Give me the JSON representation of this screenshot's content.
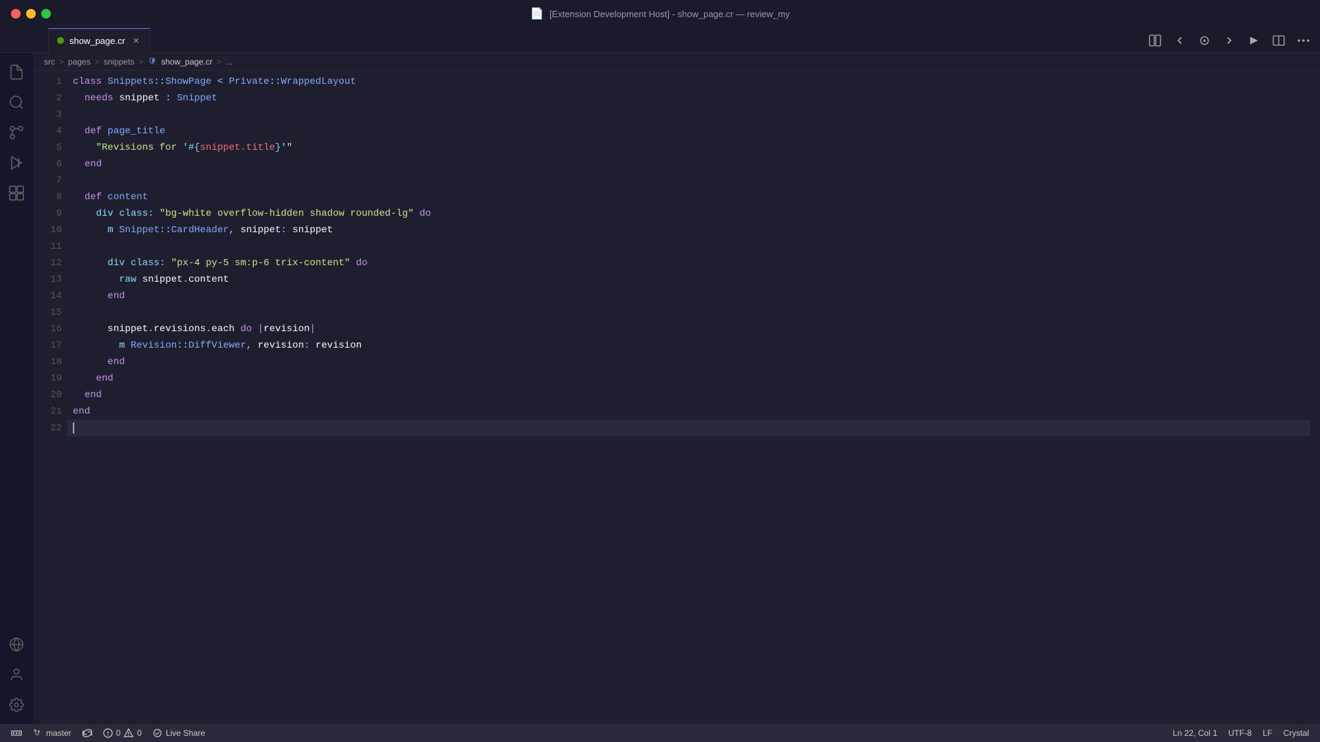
{
  "titleBar": {
    "title": "[Extension Development Host] - show_page.cr — review_my"
  },
  "tabs": [
    {
      "name": "show_page.cr",
      "active": true,
      "modified": false,
      "icon": "crystal-icon"
    }
  ],
  "breadcrumb": {
    "items": [
      "src",
      "pages",
      "snippets",
      "show_page.cr",
      "..."
    ],
    "separator": ">"
  },
  "toolbar": {
    "buttons": [
      "split-left",
      "go-back",
      "go-marker",
      "go-forward",
      "run-debug",
      "split-editor",
      "more-actions"
    ]
  },
  "code": {
    "lines": [
      {
        "num": 1,
        "tokens": [
          {
            "t": "kw",
            "v": "class "
          },
          {
            "t": "cls",
            "v": "Snippets"
          },
          {
            "t": "sym",
            "v": "::"
          },
          {
            "t": "cls",
            "v": "ShowPage"
          },
          {
            "t": "plain",
            "v": " "
          },
          {
            "t": "sym",
            "v": "<"
          },
          {
            "t": "plain",
            "v": " "
          },
          {
            "t": "cls",
            "v": "Private"
          },
          {
            "t": "sym",
            "v": "::"
          },
          {
            "t": "cls",
            "v": "WrappedLayout"
          }
        ]
      },
      {
        "num": 2,
        "tokens": [
          {
            "t": "plain",
            "v": "  "
          },
          {
            "t": "kw",
            "v": "needs "
          },
          {
            "t": "plain",
            "v": "snippet "
          },
          {
            "t": "sym",
            "v": ": "
          },
          {
            "t": "cls",
            "v": "Snippet"
          }
        ]
      },
      {
        "num": 3,
        "tokens": []
      },
      {
        "num": 4,
        "tokens": [
          {
            "t": "plain",
            "v": "  "
          },
          {
            "t": "kw",
            "v": "def "
          },
          {
            "t": "meth",
            "v": "page_title"
          }
        ]
      },
      {
        "num": 5,
        "tokens": [
          {
            "t": "plain",
            "v": "    "
          },
          {
            "t": "str",
            "v": "\"Revisions for "
          },
          {
            "t": "interp",
            "v": "'#{"
          },
          {
            "t": "interp-inner",
            "v": "snippet.title"
          },
          {
            "t": "interp",
            "v": "}"
          },
          {
            "t": "str",
            "v": "'\""
          }
        ]
      },
      {
        "num": 6,
        "tokens": [
          {
            "t": "plain",
            "v": "  "
          },
          {
            "t": "kw",
            "v": "end"
          }
        ]
      },
      {
        "num": 7,
        "tokens": []
      },
      {
        "num": 8,
        "tokens": [
          {
            "t": "plain",
            "v": "  "
          },
          {
            "t": "kw",
            "v": "def "
          },
          {
            "t": "meth",
            "v": "content"
          }
        ]
      },
      {
        "num": 9,
        "tokens": [
          {
            "t": "plain",
            "v": "    "
          },
          {
            "t": "kw2",
            "v": "div"
          },
          {
            "t": "plain",
            "v": " "
          },
          {
            "t": "kw2",
            "v": "class"
          },
          {
            "t": "sym",
            "v": ": "
          },
          {
            "t": "str",
            "v": "\"bg-white overflow-hidden shadow rounded-lg\""
          },
          {
            "t": "plain",
            "v": " "
          },
          {
            "t": "kw",
            "v": "do"
          }
        ]
      },
      {
        "num": 10,
        "tokens": [
          {
            "t": "plain",
            "v": "      "
          },
          {
            "t": "kw2",
            "v": "m"
          },
          {
            "t": "plain",
            "v": " "
          },
          {
            "t": "cls",
            "v": "Snippet"
          },
          {
            "t": "sym",
            "v": "::"
          },
          {
            "t": "cls",
            "v": "CardHeader"
          },
          {
            "t": "sym",
            "v": ", "
          },
          {
            "t": "plain",
            "v": "snippet"
          },
          {
            "t": "sym",
            "v": ": "
          },
          {
            "t": "plain",
            "v": "snippet"
          }
        ]
      },
      {
        "num": 11,
        "tokens": []
      },
      {
        "num": 12,
        "tokens": [
          {
            "t": "plain",
            "v": "      "
          },
          {
            "t": "kw2",
            "v": "div"
          },
          {
            "t": "plain",
            "v": " "
          },
          {
            "t": "kw2",
            "v": "class"
          },
          {
            "t": "sym",
            "v": ": "
          },
          {
            "t": "str",
            "v": "\"px-4 py-5 sm:p-6 trix-content\""
          },
          {
            "t": "plain",
            "v": " "
          },
          {
            "t": "kw",
            "v": "do"
          }
        ]
      },
      {
        "num": 13,
        "tokens": [
          {
            "t": "plain",
            "v": "        "
          },
          {
            "t": "kw2",
            "v": "raw"
          },
          {
            "t": "plain",
            "v": " snippet"
          },
          {
            "t": "sym",
            "v": "."
          },
          {
            "t": "plain",
            "v": "content"
          }
        ]
      },
      {
        "num": 14,
        "tokens": [
          {
            "t": "plain",
            "v": "      "
          },
          {
            "t": "kw",
            "v": "end"
          }
        ]
      },
      {
        "num": 15,
        "tokens": []
      },
      {
        "num": 16,
        "tokens": [
          {
            "t": "plain",
            "v": "      "
          },
          {
            "t": "plain",
            "v": "snippet"
          },
          {
            "t": "sym",
            "v": "."
          },
          {
            "t": "plain",
            "v": "revisions"
          },
          {
            "t": "sym",
            "v": "."
          },
          {
            "t": "plain",
            "v": "each "
          },
          {
            "t": "kw",
            "v": "do"
          },
          {
            "t": "plain",
            "v": " "
          },
          {
            "t": "pipe",
            "v": "|"
          },
          {
            "t": "plain",
            "v": "revision"
          },
          {
            "t": "pipe",
            "v": "|"
          }
        ]
      },
      {
        "num": 17,
        "tokens": [
          {
            "t": "plain",
            "v": "        "
          },
          {
            "t": "kw2",
            "v": "m"
          },
          {
            "t": "plain",
            "v": " "
          },
          {
            "t": "cls",
            "v": "Revision"
          },
          {
            "t": "sym",
            "v": "::"
          },
          {
            "t": "cls",
            "v": "DiffViewer"
          },
          {
            "t": "sym",
            "v": ", "
          },
          {
            "t": "plain",
            "v": "revision"
          },
          {
            "t": "sym",
            "v": ": "
          },
          {
            "t": "plain",
            "v": "revision"
          }
        ]
      },
      {
        "num": 18,
        "tokens": [
          {
            "t": "plain",
            "v": "      "
          },
          {
            "t": "kw",
            "v": "end"
          }
        ]
      },
      {
        "num": 19,
        "tokens": [
          {
            "t": "plain",
            "v": "    "
          },
          {
            "t": "kw",
            "v": "end"
          }
        ]
      },
      {
        "num": 20,
        "tokens": [
          {
            "t": "plain",
            "v": "  "
          },
          {
            "t": "kw",
            "v": "end"
          }
        ]
      },
      {
        "num": 21,
        "tokens": [
          {
            "t": "kw",
            "v": "end"
          }
        ]
      },
      {
        "num": 22,
        "tokens": [
          {
            "t": "cursor",
            "v": ""
          }
        ]
      }
    ]
  },
  "activityBar": {
    "items": [
      {
        "name": "explorer",
        "icon": "files-icon",
        "active": false
      },
      {
        "name": "search",
        "icon": "search-icon",
        "active": false
      },
      {
        "name": "source-control",
        "icon": "source-control-icon",
        "active": false
      },
      {
        "name": "run-debug",
        "icon": "debug-icon",
        "active": false
      },
      {
        "name": "extensions",
        "icon": "extensions-icon",
        "active": false
      }
    ],
    "bottom": [
      {
        "name": "remote",
        "icon": "remote-icon"
      },
      {
        "name": "account",
        "icon": "account-icon"
      },
      {
        "name": "settings",
        "icon": "settings-icon"
      }
    ]
  },
  "statusBar": {
    "left": [
      {
        "id": "remote",
        "icon": "remote-icon",
        "text": ""
      },
      {
        "id": "branch",
        "icon": "git-icon",
        "text": "master"
      },
      {
        "id": "sync",
        "icon": "sync-icon",
        "text": ""
      },
      {
        "id": "errors",
        "icon": "error-icon",
        "text": "0"
      },
      {
        "id": "warnings",
        "icon": "warning-icon",
        "text": "0"
      },
      {
        "id": "liveshare",
        "icon": "liveshare-icon",
        "text": "Live Share"
      }
    ],
    "right": [
      {
        "id": "position",
        "text": "Ln 22, Col 1"
      },
      {
        "id": "encoding",
        "text": "UTF-8"
      },
      {
        "id": "eol",
        "text": "LF"
      },
      {
        "id": "language",
        "text": "Crystal"
      }
    ]
  }
}
